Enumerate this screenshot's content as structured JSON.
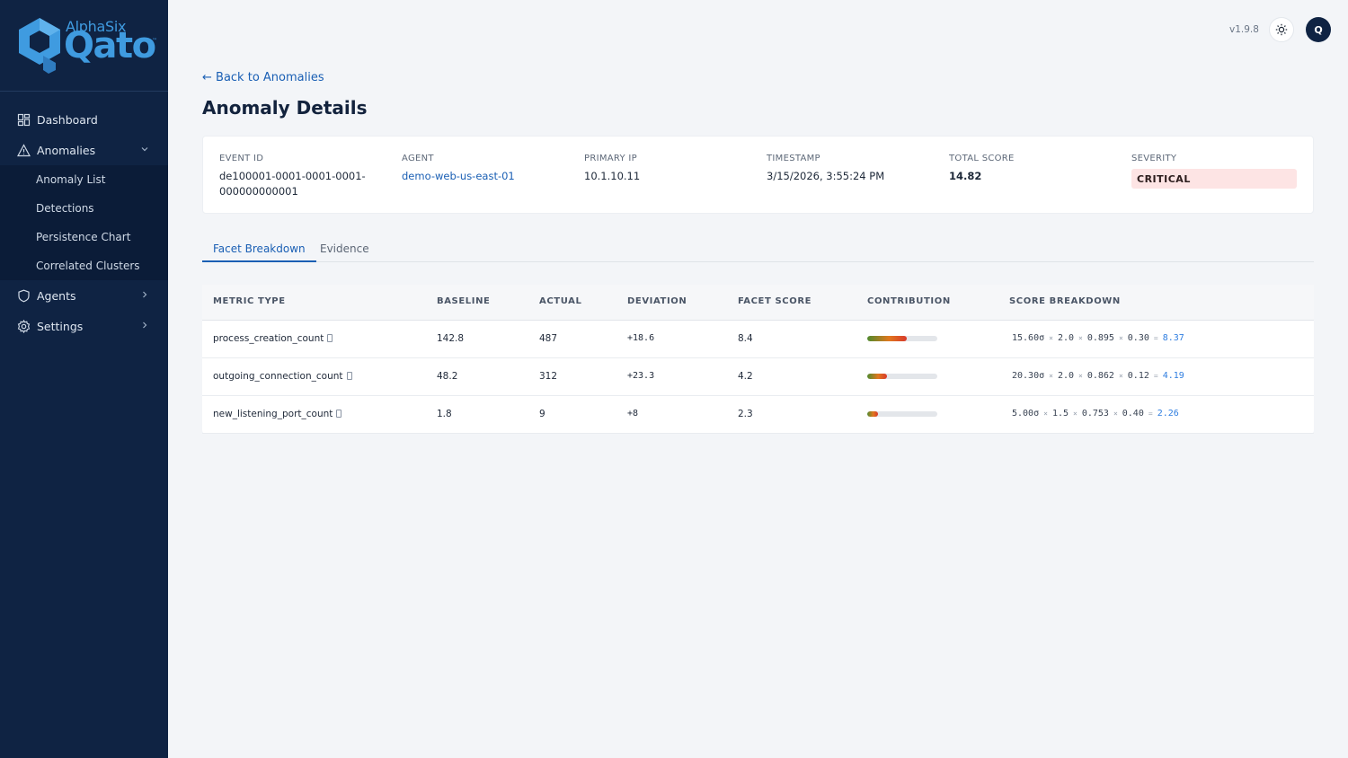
{
  "brand": {
    "top": "AlphaSix",
    "main": "Qato",
    "tm": "™"
  },
  "sidebar": {
    "items": [
      {
        "label": "Dashboard"
      },
      {
        "label": "Anomalies"
      },
      {
        "label": "Agents"
      },
      {
        "label": "Settings"
      }
    ],
    "anomalies_sub": [
      {
        "label": "Anomaly List"
      },
      {
        "label": "Detections"
      },
      {
        "label": "Persistence Chart"
      },
      {
        "label": "Correlated Clusters"
      }
    ]
  },
  "header": {
    "version": "v1.9.8",
    "avatar": "Q"
  },
  "page": {
    "back": "← Back to Anomalies",
    "title": "Anomaly Details"
  },
  "summary": {
    "event_id": {
      "label": "EVENT ID",
      "line1": "de100001-0001-0001-0001-",
      "line2": "000000000001"
    },
    "agent": {
      "label": "AGENT",
      "value": "demo-web-us-east-01"
    },
    "primary_ip": {
      "label": "PRIMARY IP",
      "value": "10.1.10.11"
    },
    "timestamp": {
      "label": "TIMESTAMP",
      "value": "3/15/2026, 3:55:24 PM"
    },
    "total_score": {
      "label": "TOTAL SCORE",
      "value": "14.82"
    },
    "severity": {
      "label": "SEVERITY",
      "value": "CRITICAL"
    }
  },
  "tabs": [
    {
      "label": "Facet Breakdown"
    },
    {
      "label": "Evidence"
    }
  ],
  "table": {
    "headers": [
      "METRIC TYPE",
      "BASELINE",
      "ACTUAL",
      "DEVIATION",
      "FACET SCORE",
      "CONTRIBUTION",
      "SCORE BREAKDOWN"
    ],
    "rows": [
      {
        "metric": "process_creation_count",
        "baseline": "142.8",
        "actual": "487",
        "deviation": "+18.6",
        "facet_score": "8.4",
        "contribution": 0.57,
        "b1": "15.60σ",
        "b2": "2.0",
        "b3": "0.895",
        "b4": "0.30",
        "result": "8.37"
      },
      {
        "metric": "outgoing_connection_count",
        "baseline": "48.2",
        "actual": "312",
        "deviation": "+23.3",
        "facet_score": "4.2",
        "contribution": 0.28,
        "b1": "20.30σ",
        "b2": "2.0",
        "b3": "0.862",
        "b4": "0.12",
        "result": "4.19"
      },
      {
        "metric": "new_listening_port_count",
        "baseline": "1.8",
        "actual": "9",
        "deviation": "+8",
        "facet_score": "2.3",
        "contribution": 0.15,
        "b1": "5.00σ",
        "b2": "1.5",
        "b3": "0.753",
        "b4": "0.40",
        "result": "2.26"
      }
    ],
    "ops": {
      "times": "×",
      "equals": "="
    }
  },
  "colors": {
    "sidebar": "#0f2343",
    "accent": "#1a5fb4",
    "critical_bg": "#fde4e4"
  },
  "icons": [
    "dashboard-icon",
    "alert-triangle-icon",
    "shield-icon",
    "gear-icon",
    "sun-icon",
    "chevron-down-icon",
    "chevron-right-icon",
    "info-icon"
  ]
}
